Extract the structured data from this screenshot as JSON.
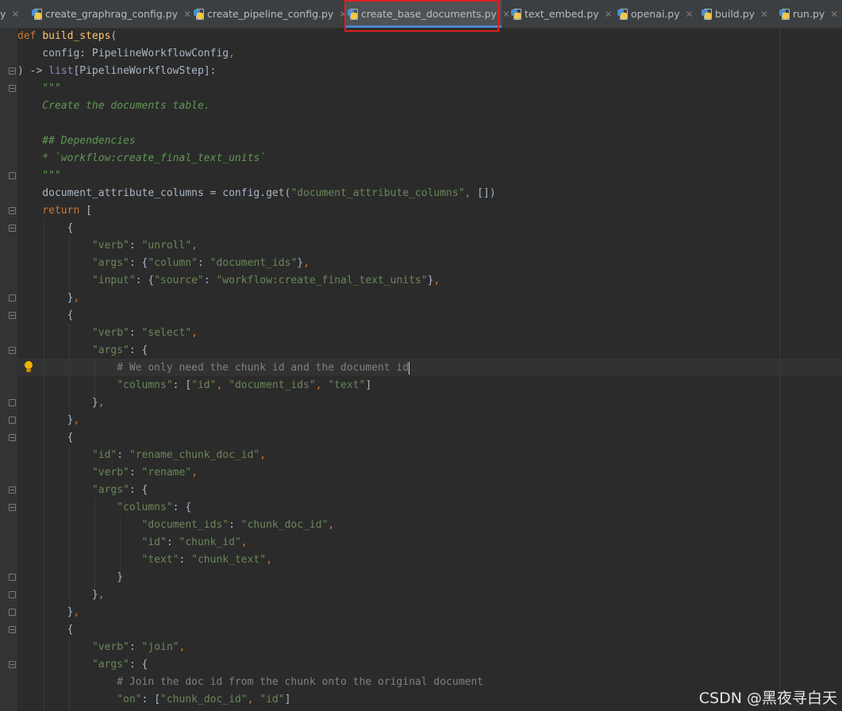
{
  "tabs": [
    {
      "label": "y",
      "active": false
    },
    {
      "label": "create_graphrag_config.py",
      "active": false
    },
    {
      "label": "create_pipeline_config.py",
      "active": false
    },
    {
      "label": "create_base_documents.py",
      "active": true
    },
    {
      "label": "text_embed.py",
      "active": false
    },
    {
      "label": "openai.py",
      "active": false
    },
    {
      "label": "build.py",
      "active": false
    },
    {
      "label": "run.py",
      "active": false
    }
  ],
  "code": {
    "l1_kw": "def ",
    "l1_fn": "build_steps",
    "l1_p": "(",
    "l2_a": "    config: PipelineWorkflowConfig",
    "l2_b": ",",
    "l3_a": ") -> ",
    "l3_b": "list",
    "l3_c": "[PipelineWorkflowStep]:",
    "l4": "    \"\"\"",
    "l5": "    Create the documents table.",
    "l6": "",
    "l7": "    ## Dependencies",
    "l8": "    * `workflow:create_final_text_units`",
    "l9": "    \"\"\"",
    "l10_a": "    document_attribute_columns = config.get(",
    "l10_b": "\"document_attribute_columns\"",
    "l10_c": ", ",
    "l10_d": "[])",
    "l11_a": "    return",
    "l11_b": " [",
    "l12": "        {",
    "l13_a": "            \"verb\"",
    "l13_b": ": ",
    "l13_c": "\"unroll\"",
    "l13_d": ",",
    "l14_a": "            \"args\"",
    "l14_b": ": {",
    "l14_c": "\"column\"",
    "l14_d": ": ",
    "l14_e": "\"document_ids\"",
    "l14_f": "}",
    "l14_g": ",",
    "l15_a": "            \"input\"",
    "l15_b": ": {",
    "l15_c": "\"source\"",
    "l15_d": ": ",
    "l15_e": "\"workflow:create_final_text_units\"",
    "l15_f": "}",
    "l15_g": ",",
    "l16_a": "        }",
    "l16_b": ",",
    "l17": "        {",
    "l18_a": "            \"verb\"",
    "l18_b": ": ",
    "l18_c": "\"select\"",
    "l18_d": ",",
    "l19_a": "            \"args\"",
    "l19_b": ": {",
    "l20": "                # We only need the chunk id and the document id",
    "l21_a": "                \"columns\"",
    "l21_b": ": [",
    "l21_c": "\"id\"",
    "l21_d": ", ",
    "l21_e": "\"document_ids\"",
    "l21_f": ", ",
    "l21_g": "\"text\"",
    "l21_h": "]",
    "l22_a": "            }",
    "l22_b": ",",
    "l23_a": "        }",
    "l23_b": ",",
    "l24": "        {",
    "l25_a": "            \"id\"",
    "l25_b": ": ",
    "l25_c": "\"rename_chunk_doc_id\"",
    "l25_d": ",",
    "l26_a": "            \"verb\"",
    "l26_b": ": ",
    "l26_c": "\"rename\"",
    "l26_d": ",",
    "l27_a": "            \"args\"",
    "l27_b": ": {",
    "l28_a": "                \"columns\"",
    "l28_b": ": {",
    "l29_a": "                    \"document_ids\"",
    "l29_b": ": ",
    "l29_c": "\"chunk_doc_id\"",
    "l29_d": ",",
    "l30_a": "                    \"id\"",
    "l30_b": ": ",
    "l30_c": "\"chunk_id\"",
    "l30_d": ",",
    "l31_a": "                    \"text\"",
    "l31_b": ": ",
    "l31_c": "\"chunk_text\"",
    "l31_d": ",",
    "l32": "                }",
    "l33_a": "            }",
    "l33_b": ",",
    "l34_a": "        }",
    "l34_b": ",",
    "l35": "        {",
    "l36_a": "            \"verb\"",
    "l36_b": ": ",
    "l36_c": "\"join\"",
    "l36_d": ",",
    "l37_a": "            \"args\"",
    "l37_b": ": {",
    "l38": "                # Join the doc id from the chunk onto the original document",
    "l39_a": "                \"on\"",
    "l39_b": ": [",
    "l39_c": "\"chunk_doc_id\"",
    "l39_d": ", ",
    "l39_e": "\"id\"",
    "l39_f": "]"
  },
  "watermark": "CSDN @黑夜寻白天",
  "colors": {
    "background": "#2b2b2b",
    "keyword": "#cc7832",
    "string": "#6a8759",
    "docstring": "#629755",
    "comment": "#808080",
    "function": "#ffc66d",
    "highlight_box": "#e02020"
  }
}
